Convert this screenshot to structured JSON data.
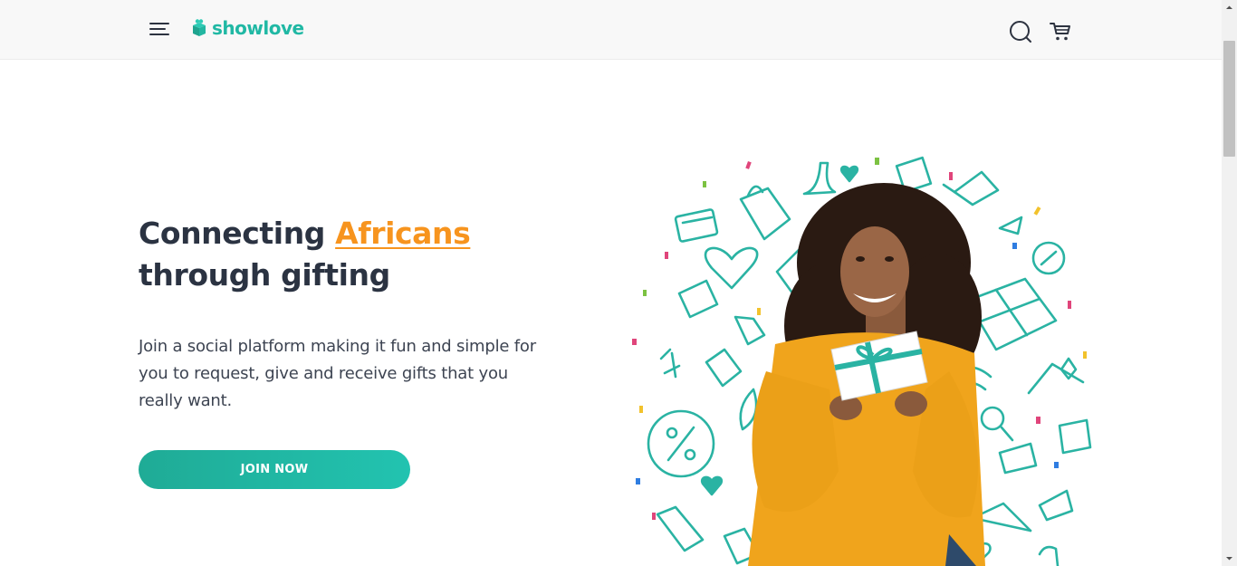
{
  "header": {
    "brand": "showlove",
    "icons": {
      "menu": "hamburger-menu-icon",
      "search": "search-icon",
      "cart": "cart-icon"
    }
  },
  "hero": {
    "title_prefix": "Connecting ",
    "title_accent": "Africans",
    "title_suffix": "through gifting",
    "description": "Join a social platform making it fun and simple for you to request, give and receive gifts that you really want.",
    "cta_label": "JOIN NOW",
    "illustration": "woman-holding-gift-with-gift-doodle-icons"
  },
  "colors": {
    "brand_teal": "#20b8a4",
    "accent_orange": "#f7941e",
    "text_dark": "#2b3342",
    "header_bg": "#f8f8f8",
    "sweater_yellow": "#f0a41c"
  }
}
